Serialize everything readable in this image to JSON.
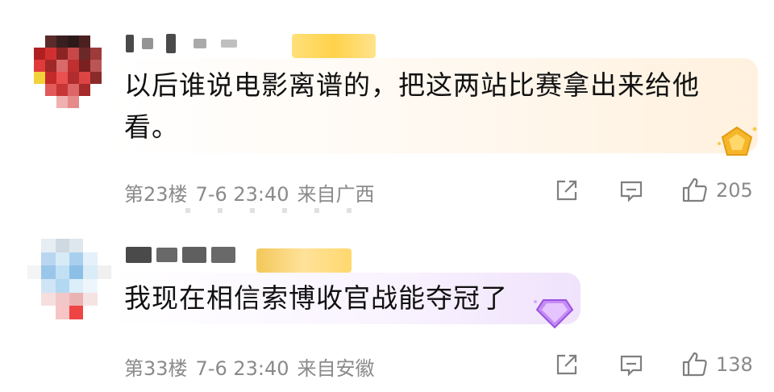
{
  "comments": [
    {
      "text": "以后谁说电影离谱的，把这两站比赛拿出来给他看。",
      "floor": "第23楼",
      "time": "7-6 23:40",
      "location": "来自广西",
      "likes": "205",
      "badge": "gold-gem"
    },
    {
      "text": "我现在相信索博收官战能夺冠了",
      "floor": "第33楼",
      "time": "7-6 23:40",
      "location": "来自安徽",
      "likes": "138",
      "badge": "purple-gem"
    }
  ],
  "icons": {
    "share": "share-icon",
    "comment": "comment-icon",
    "like": "thumb-up-icon"
  },
  "colors": {
    "meta_text": "#8a8a8a",
    "gold_gem": "#f6b62a",
    "purple_gem": "#b873f0"
  }
}
